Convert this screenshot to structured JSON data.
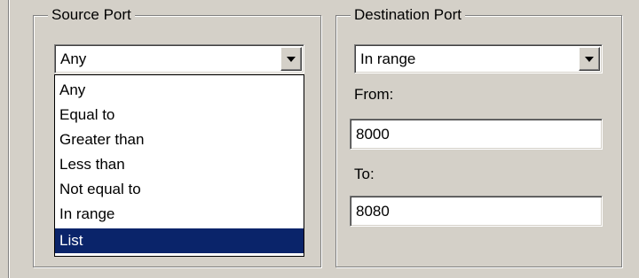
{
  "source_port": {
    "legend": "Source Port",
    "combo_value": "Any",
    "options": [
      "Any",
      "Equal to",
      "Greater than",
      "Less than",
      "Not equal to",
      "In range",
      "List"
    ],
    "highlighted_option": "List"
  },
  "destination_port": {
    "legend": "Destination Port",
    "combo_value": "In range",
    "from_label": "From:",
    "from_value": "8000",
    "to_label": "To:",
    "to_value": "8080"
  },
  "colors": {
    "dialog_bg": "#d4d0c8",
    "selection_bg": "#0a246a",
    "selection_text": "#ffffff"
  }
}
